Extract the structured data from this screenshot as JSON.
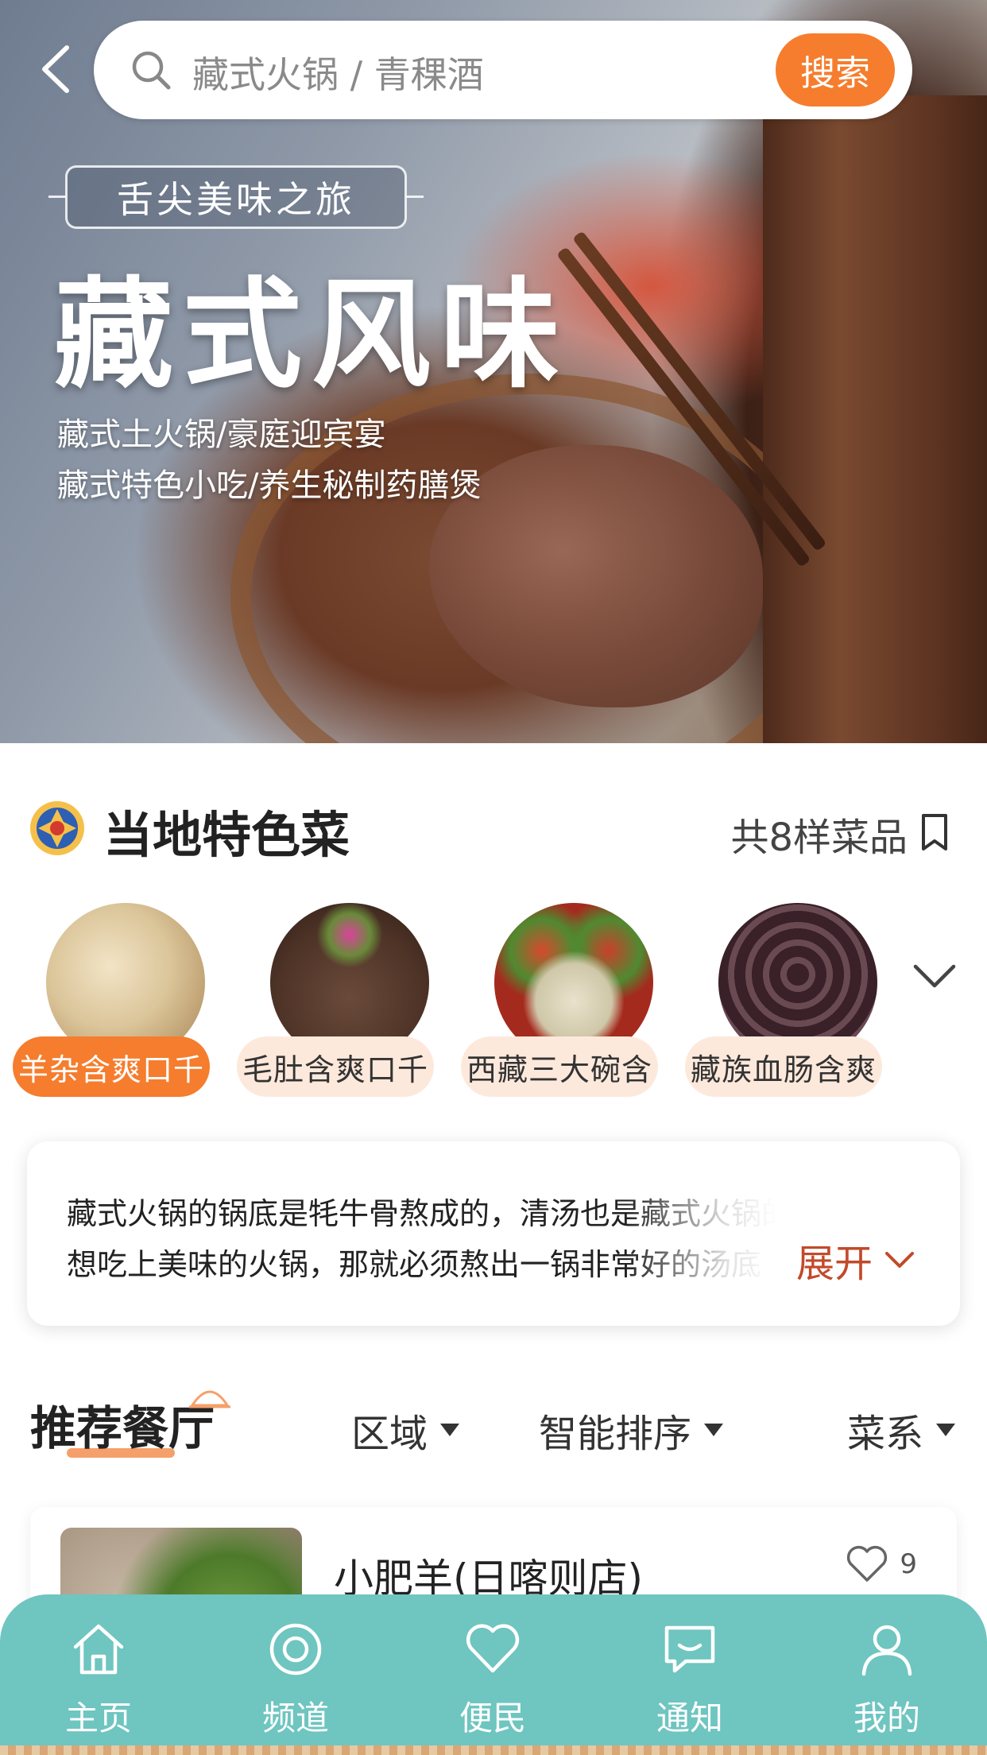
{
  "search": {
    "placeholder": "藏式火锅 / 青稞酒",
    "button": "搜索"
  },
  "hero": {
    "ribbon": "舌尖美味之旅",
    "title": "藏式风味",
    "sub_line1": "藏式土火锅/豪庭迎宾宴",
    "sub_line2": "藏式特色小吃/养生秘制药膳煲"
  },
  "local": {
    "title": "当地特色菜",
    "count": "共8样菜品",
    "dishes": [
      {
        "label": "羊杂含爽口千",
        "active": true
      },
      {
        "label": "毛肚含爽口千",
        "active": false
      },
      {
        "label": "西藏三大碗含",
        "active": false
      },
      {
        "label": "藏族血肠含爽",
        "active": false
      }
    ]
  },
  "description": {
    "line1": "藏式火锅的锅底是牦牛骨熬成的，清汤也是藏式火锅的关键要",
    "line2": "想吃上美味的火锅，那就必须熬出一锅非常好的汤底",
    "expand": "展开"
  },
  "recommend": {
    "title": "推荐餐厅",
    "filters": [
      "区域",
      "智能排序",
      "菜系"
    ],
    "restaurant": {
      "name": "小肥羊(日喀则店)",
      "likes": "9"
    }
  },
  "tabbar": [
    "主页",
    "频道",
    "便民",
    "通知",
    "我的"
  ],
  "colors": {
    "accent": "#f57d2d",
    "tabbar": "#6fc5c0",
    "expand": "#c24a2a"
  },
  "icons": [
    "back-icon",
    "search-icon",
    "mandala-icon",
    "bookmark-icon",
    "chevron-down-icon",
    "heart-icon",
    "home-icon",
    "channel-icon",
    "service-icon",
    "message-icon",
    "user-icon"
  ]
}
